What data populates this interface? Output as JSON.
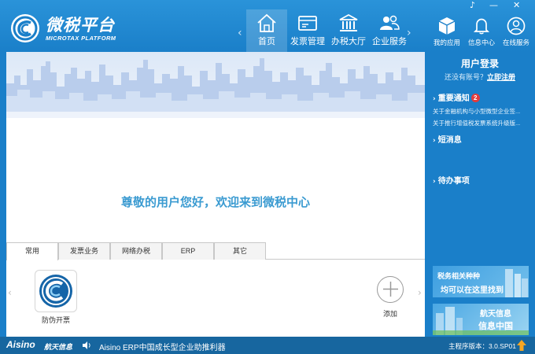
{
  "app": {
    "name_cn": "微税平台",
    "name_en": "MICROTAX PLATFORM"
  },
  "window_controls": [
    "♪",
    "—",
    "✕"
  ],
  "nav": {
    "items": [
      {
        "label": "首页",
        "icon": "home-icon",
        "active": true
      },
      {
        "label": "发票管理",
        "icon": "invoice-icon",
        "active": false
      },
      {
        "label": "办税大厅",
        "icon": "tax-hall-icon",
        "active": false
      },
      {
        "label": "企业服务",
        "icon": "enterprise-icon",
        "active": false
      }
    ],
    "prev_arrow": "‹",
    "next_arrow": "›"
  },
  "top_icons": [
    {
      "label": "我的应用",
      "icon": "my-apps-icon"
    },
    {
      "label": "信息中心",
      "icon": "bell-icon"
    },
    {
      "label": "在线服务",
      "icon": "online-service-icon"
    }
  ],
  "main": {
    "welcome": "尊敬的用户您好，欢迎来到微税中心",
    "tabs": [
      "常用",
      "发票业务",
      "网络办税",
      "ERP",
      "其它"
    ],
    "active_tab": 0,
    "apps": [
      {
        "label": "防伪开票",
        "icon": "anti-counterfeit-invoice-icon"
      }
    ],
    "add_label": "添加",
    "left_arrow": "‹",
    "right_arrow": "›"
  },
  "side": {
    "login_title": "用户登录",
    "login_prompt": "还没有账号？",
    "register_link": "立即注册",
    "notice_head": "重要通知",
    "notice_badge": "2",
    "notices": [
      "关于金融机构与小型微型企业签...",
      "关于推行增值税发票系统升级版..."
    ],
    "sms_head": "短消息",
    "todo_head": "待办事项",
    "ad1": {
      "line1": "税务相关种种",
      "line2": "均可以在这里找到"
    },
    "ad2": {
      "line1": "航天信息",
      "line2": "信息中国"
    }
  },
  "footer": {
    "brand": "Aisino",
    "brand_cn": "航天信息",
    "ticker": "Aisino ERP中国成长型企业助推利器",
    "version": "主程序版本：3.0.SP01"
  },
  "colors": {
    "header_blue": "#1a7fc9",
    "welcome_text": "#3b9bd1",
    "badge_red": "#e23b3b",
    "upgrade_arrow": "#f5a623"
  }
}
